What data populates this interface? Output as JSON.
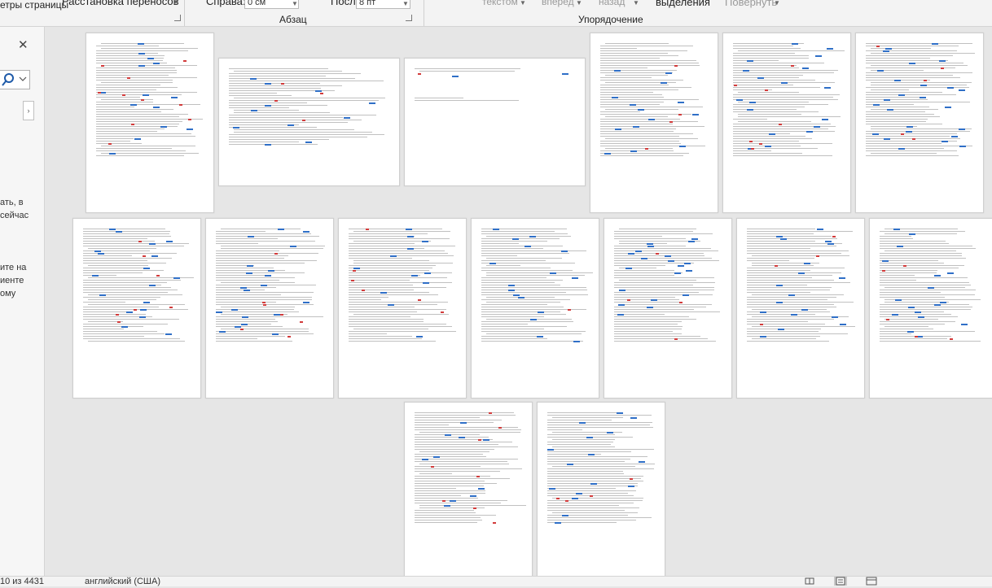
{
  "ribbon": {
    "page_setup_group": "етры страницы",
    "hyphenation_label": "Расстановка переносов",
    "indent_right_label": "Справа:",
    "indent_right_value": "0 см",
    "spacing_after_label": "После:",
    "spacing_after_value": "8 пт",
    "paragraph_group": "Абзац",
    "wrap_text": "текстом",
    "bring_forward": "вперед",
    "send_backward": "назад",
    "selection_pane": "выделения",
    "rotate": "Повернуть",
    "arrange_group": "Упорядочение"
  },
  "nav_pane": {
    "fragment_1": "ать, в",
    "fragment_2": "сейчас",
    "fragment_3": "ите на",
    "fragment_4": "иенте",
    "fragment_5": "ому"
  },
  "status_bar": {
    "word_count": "10 из 4431",
    "language": "английский (США)"
  },
  "colors": {
    "highlight_blue": "#2f6fc7",
    "misspelling_red": "#d23b3b"
  },
  "icons": [
    "close-icon",
    "search-icon",
    "chevron-down-icon",
    "collapse-arrow-icon",
    "read-mode-icon",
    "print-layout-icon",
    "web-layout-icon"
  ]
}
